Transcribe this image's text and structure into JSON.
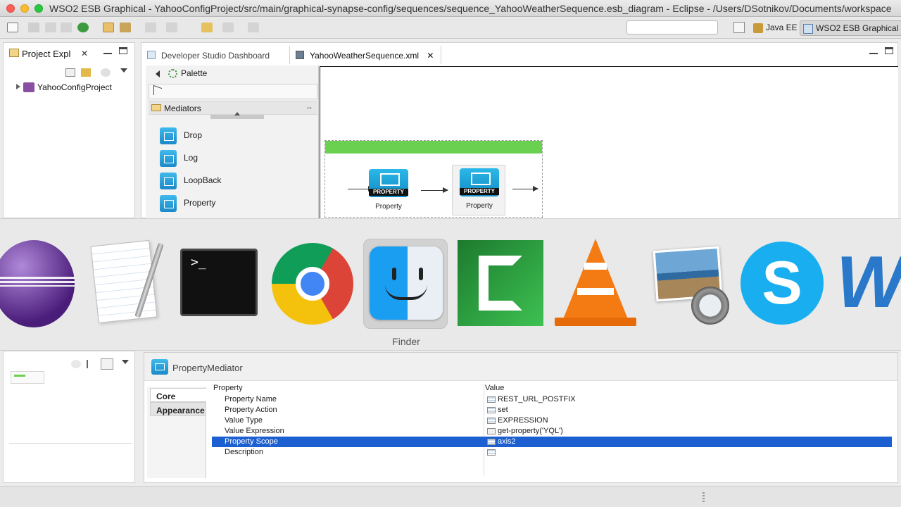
{
  "window": {
    "title": "WSO2 ESB Graphical - YahooConfigProject/src/main/graphical-synapse-config/sequences/sequence_YahooWeatherSequence.esb_diagram - Eclipse - /Users/DSotnikov/Documents/workspace"
  },
  "toolbar": {
    "search_value": "",
    "perspectives": [
      "Java EE",
      "WSO2 ESB Graphical"
    ]
  },
  "project_explorer": {
    "tab_label": "Project Expl",
    "items": [
      "YahooConfigProject"
    ]
  },
  "editor": {
    "tabs": [
      "Developer Studio Dashboard",
      "YahooWeatherSequence.xml"
    ]
  },
  "palette": {
    "title": "Palette",
    "drawer": "Mediators",
    "items": [
      "Drop",
      "Log",
      "LoopBack",
      "Property"
    ]
  },
  "diagram": {
    "nodes": [
      {
        "badge": "PROPERTY",
        "label": "Property"
      },
      {
        "badge": "PROPERTY",
        "label": "Property"
      }
    ]
  },
  "app_switcher": {
    "apps": [
      "eclipse-icon",
      "textedit-icon",
      "terminal-icon",
      "chrome-icon",
      "finder-icon",
      "camtasia-icon",
      "vlc-icon",
      "preview-icon",
      "skype-icon",
      "word-icon"
    ],
    "selected_label": "Finder"
  },
  "properties": {
    "title": "PropertyMediator",
    "side_tabs": [
      "Core",
      "Appearance"
    ],
    "headers": {
      "property": "Property",
      "value": "Value"
    },
    "rows": [
      {
        "name": "Property Name",
        "value": "REST_URL_POSTFIX"
      },
      {
        "name": "Property Action",
        "value": "set"
      },
      {
        "name": "Value Type",
        "value": "EXPRESSION"
      },
      {
        "name": "Value Expression",
        "value": "get-property('YQL')"
      },
      {
        "name": "Property Scope",
        "value": "axis2"
      },
      {
        "name": "Description",
        "value": ""
      }
    ],
    "selected_row": "Property Scope"
  },
  "colors": {
    "selection": "#1c5fd0",
    "sequence_bar": "#6ad04f",
    "mediator_blue": "#1a8ac8"
  }
}
